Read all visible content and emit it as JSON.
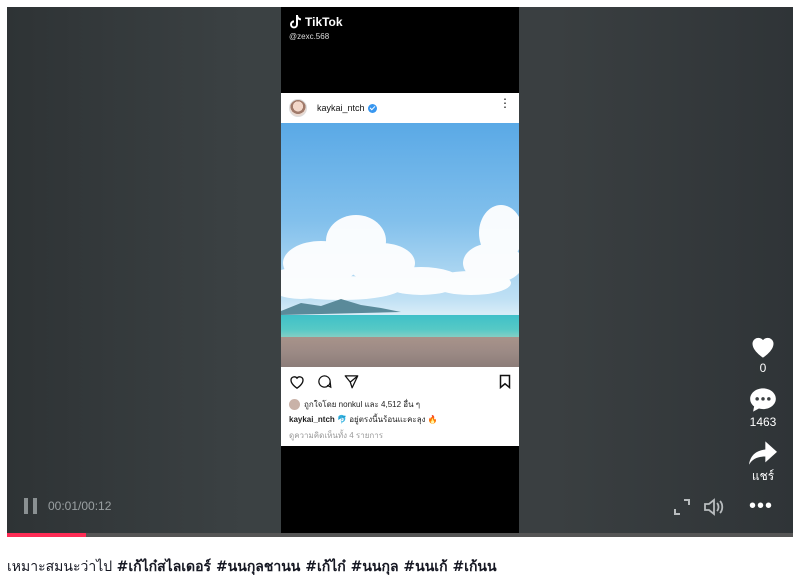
{
  "tiktok": {
    "brand": "TikTok",
    "handle": "@zexc.568"
  },
  "post": {
    "username": "kaykai_ntch",
    "liked_by": "ถูกใจโดย nonkul และ 4,512 อื่น ๆ",
    "caption_user": "kaykai_ntch",
    "caption_text": "🐬 อยู่ตรงนี้นร้อนแะคะลุง 🔥",
    "comments": "ดูความคิดเห็นทั้ง 4 รายการ"
  },
  "actions": {
    "likes": "0",
    "comments": "1463",
    "share_label": "แชร์"
  },
  "player": {
    "time": "00:01/00:12",
    "progress": 0.1
  },
  "description": {
    "plain": "เหมาะสมนะว่าไป ",
    "hashtags": "#เก้ไก๋สไลเดอร์ #นนกุลชานน #เก้ไก๋ #นนกุล #นนเก้ #เก้นน"
  },
  "colors": {
    "accent": "#fe2c55",
    "verified": "#3897f0"
  },
  "icons": [
    "tiktok-logo-icon",
    "verified-icon",
    "more-vertical-icon",
    "heart-outline-icon",
    "comment-icon",
    "send-icon",
    "bookmark-icon",
    "heart-icon",
    "comment-bubble-icon",
    "share-icon",
    "pause-icon",
    "fullscreen-icon",
    "volume-icon",
    "more-horizontal-icon"
  ]
}
